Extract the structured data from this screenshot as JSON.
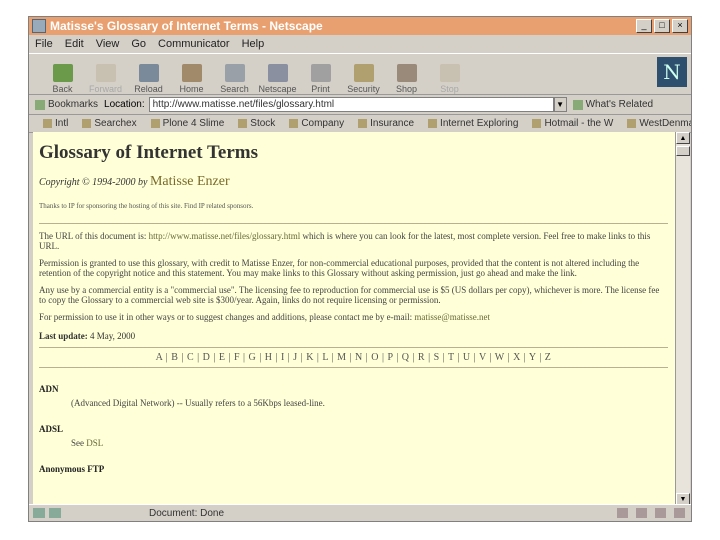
{
  "window": {
    "title": "Matisse's Glossary of Internet Terms - Netscape"
  },
  "menu": [
    "File",
    "Edit",
    "View",
    "Go",
    "Communicator",
    "Help"
  ],
  "toolbar": [
    {
      "label": "Back",
      "icon": "back-icon",
      "color": "#6a9a4a",
      "enabled": true
    },
    {
      "label": "Forward",
      "icon": "forward-icon",
      "color": "#c8c0b0",
      "enabled": false
    },
    {
      "label": "Reload",
      "icon": "reload-icon",
      "color": "#7a8a9a",
      "enabled": true
    },
    {
      "label": "Home",
      "icon": "home-icon",
      "color": "#a08a6a",
      "enabled": true
    },
    {
      "label": "Search",
      "icon": "search-icon",
      "color": "#9aa0a8",
      "enabled": true
    },
    {
      "label": "Netscape",
      "icon": "netscape-icon",
      "color": "#8a90a0",
      "enabled": true
    },
    {
      "label": "Print",
      "icon": "print-icon",
      "color": "#a0a0a0",
      "enabled": true
    },
    {
      "label": "Security",
      "icon": "security-icon",
      "color": "#b0a070",
      "enabled": true
    },
    {
      "label": "Shop",
      "icon": "shop-icon",
      "color": "#9a8a7a",
      "enabled": true
    },
    {
      "label": "Stop",
      "icon": "stop-icon",
      "color": "#c8c0b0",
      "enabled": false
    }
  ],
  "location": {
    "bookmarks_label": "Bookmarks",
    "location_label": "Location:",
    "url": "http://www.matisse.net/files/glossary.html",
    "related_label": "What's Related"
  },
  "personal_bar": [
    "Intl",
    "Searchex",
    "Plone 4 Slime",
    "Stock",
    "Company",
    "Insurance",
    "Internet Exploring",
    "Hotmail - the W",
    "WestDenmark"
  ],
  "page": {
    "title": "Glossary of Internet Terms",
    "copyright_prefix": "Copyright © 1994-2000 by",
    "author": "Matisse Enzer",
    "small_note": "Thanks to IP for sponsoring the hosting of this site. Find IP related sponsors.",
    "para1_before": "The URL of this document is:",
    "para1_link": "http://www.matisse.net/files/glossary.html",
    "para1_after": "which is where you can look for the latest, most complete version. Feel free to make links to this URL.",
    "para2": "Permission is granted to use this glossary, with credit to Matisse Enzer, for non-commercial educational purposes, provided that the content is not altered including the retention of the copyright notice and this statement. You may make links to this Glossary without asking permission, just go ahead and make the link.",
    "para3": "Any use by a commercial entity is a \"commercial use\". The licensing fee to reproduction for commercial use is $5 (US dollars per copy), whichever is more. The license fee to copy the Glossary to a commercial web site is $300/year. Again, links do not require licensing or permission.",
    "para4_before": "For permission to use it in other ways or to suggest changes and additions, please contact me by e-mail:",
    "para4_link": "matisse@matisse.net",
    "last_update_label": "Last update:",
    "last_update_value": "4 May, 2000",
    "alphabet": "A | B | C | D | E | F | G | H | I | J | K | L | M | N | O | P | Q | R | S | T | U | V | W | X | Y | Z",
    "term1": "ADN",
    "def1": "(Advanced Digital Network) -- Usually refers to a 56Kbps leased-line.",
    "term2": "ADSL",
    "def2_prefix": "See",
    "def2_link": "DSL",
    "term3": "Anonymous FTP"
  },
  "status": {
    "text": "Document: Done"
  }
}
